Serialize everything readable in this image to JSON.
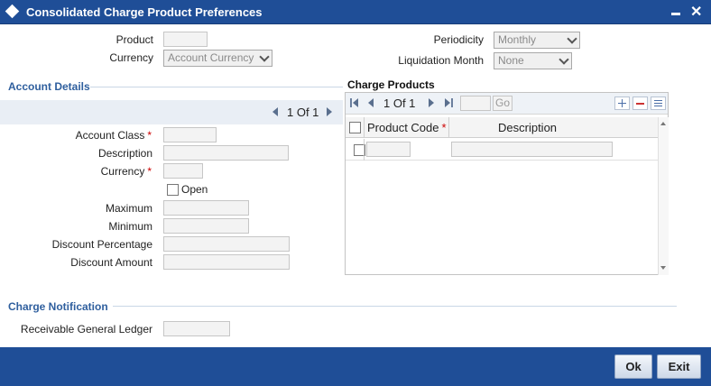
{
  "window": {
    "title": "Consolidated Charge Product Preferences",
    "close_glyph": "✕"
  },
  "header": {
    "product_label": "Product",
    "currency_label": "Currency",
    "currency_value": "Account Currency",
    "periodicity_label": "Periodicity",
    "periodicity_value": "Monthly",
    "liquidation_label": "Liquidation Month",
    "liquidation_value": "None"
  },
  "account_details": {
    "title": "Account Details",
    "pager_text": "1 Of 1",
    "account_class_label": "Account Class",
    "description_label": "Description",
    "currency_label": "Currency",
    "open_label": "Open",
    "maximum_label": "Maximum",
    "minimum_label": "Minimum",
    "discount_percentage_label": "Discount Percentage",
    "discount_amount_label": "Discount Amount",
    "required_mark": "*"
  },
  "charge_products": {
    "title": "Charge Products",
    "pager_text": "1 Of 1",
    "go_label": "Go",
    "columns": [
      "Product Code",
      "Description"
    ],
    "required_mark": "*"
  },
  "charge_notification": {
    "title": "Charge Notification",
    "receivable_gl_label": "Receivable General Ledger"
  },
  "footer": {
    "ok_label": "Ok",
    "exit_label": "Exit"
  },
  "colors": {
    "title_bar": "#1f4e97",
    "section_title": "#2f5f9e",
    "required": "#cc0000"
  }
}
